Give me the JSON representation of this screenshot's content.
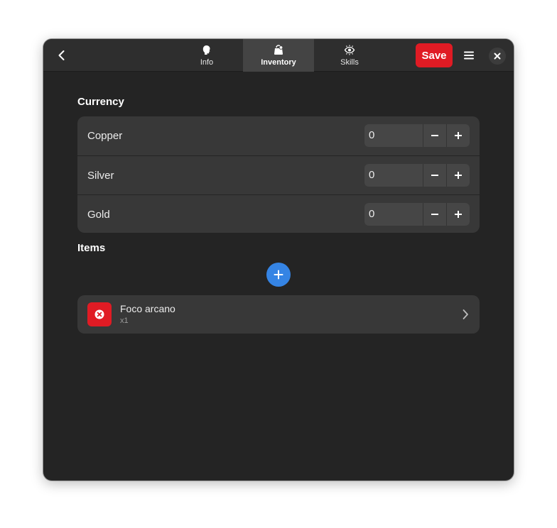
{
  "header": {
    "tabs": [
      {
        "label": "Info",
        "icon": "head-profile-icon"
      },
      {
        "label": "Inventory",
        "icon": "bag-icon"
      },
      {
        "label": "Skills",
        "icon": "eye-icon"
      }
    ],
    "active_tab": "Inventory",
    "save_label": "Save",
    "accent_color": "#e01b24"
  },
  "currency": {
    "title": "Currency",
    "rows": [
      {
        "label": "Copper",
        "value": "0"
      },
      {
        "label": "Silver",
        "value": "0"
      },
      {
        "label": "Gold",
        "value": "0"
      }
    ]
  },
  "items": {
    "title": "Items",
    "add_button_color": "#3584e4",
    "list": [
      {
        "name": "Foco arcano",
        "quantity": "x1"
      }
    ]
  }
}
